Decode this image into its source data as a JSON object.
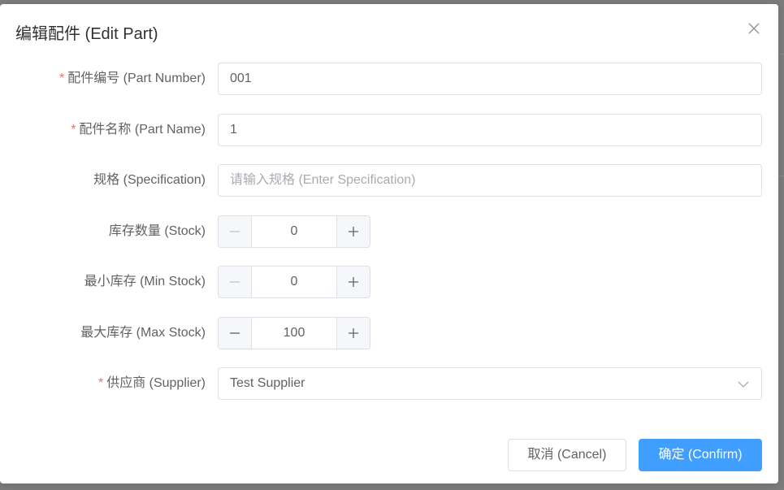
{
  "dialog": {
    "title": "编辑配件 (Edit Part)",
    "close_icon": "close-icon"
  },
  "form": {
    "required_mark": "*",
    "part_number": {
      "label": "配件编号 (Part Number)",
      "required": true,
      "value": "001"
    },
    "part_name": {
      "label": "配件名称 (Part Name)",
      "required": true,
      "value": "1"
    },
    "specification": {
      "label": "规格 (Specification)",
      "required": false,
      "value": "",
      "placeholder": "请输入规格 (Enter Specification)"
    },
    "stock": {
      "label": "库存数量 (Stock)",
      "required": false,
      "value": "0"
    },
    "min_stock": {
      "label": "最小库存 (Min Stock)",
      "required": false,
      "value": "0"
    },
    "max_stock": {
      "label": "最大库存 (Max Stock)",
      "required": false,
      "value": "100"
    },
    "supplier": {
      "label": "供应商 (Supplier)",
      "required": true,
      "value": "Test Supplier"
    }
  },
  "footer": {
    "cancel_label": "取消 (Cancel)",
    "confirm_label": "确定 (Confirm)"
  },
  "colors": {
    "primary": "#409eff",
    "required": "#f56c6c",
    "border": "#dcdfe6",
    "text": "#606266",
    "placeholder": "#a8abb2"
  }
}
